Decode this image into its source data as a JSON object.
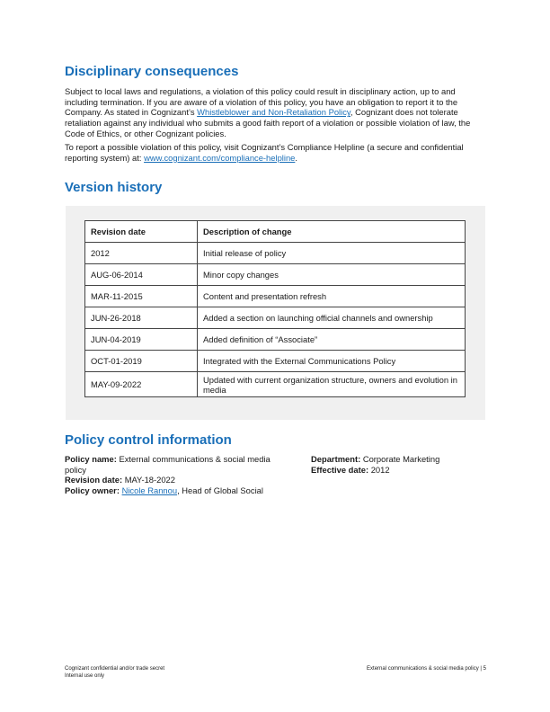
{
  "disciplinary": {
    "heading": "Disciplinary consequences",
    "p1_text_a": "Subject to local laws and regulations, a violation of this policy could result in disciplinary action, up to and including termination. If you are aware of a violation of this policy, you have an obligation to report it to the Company. As stated in Cognizant’s ",
    "p1_link": "Whistleblower and Non-Retaliation Policy",
    "p1_text_b": ", Cognizant does not tolerate retaliation against any individual who submits a good faith report of a violation or possible violation of law, the Code of Ethics, or other Cognizant policies.",
    "p2_text_a": "To report a possible violation of this policy, visit Cognizant’s Compliance Helpline (a secure and confidential reporting system) at: ",
    "p2_link": "www.cognizant.com/compliance-helpline",
    "p2_text_b": "."
  },
  "version_history": {
    "heading": "Version history",
    "columns": [
      "Revision date",
      "Description of change"
    ],
    "rows": [
      {
        "date": "2012",
        "change": "Initial release of policy"
      },
      {
        "date": "AUG-06-2014",
        "change": "Minor copy changes"
      },
      {
        "date": "MAR-11-2015",
        "change": "Content and presentation refresh"
      },
      {
        "date": "JUN-26-2018",
        "change": "Added a section on launching official channels and ownership"
      },
      {
        "date": "JUN-04-2019",
        "change": "Added definition of “Associate”"
      },
      {
        "date": "OCT-01-2019",
        "change": "Integrated with the External Communications Policy"
      },
      {
        "date": "MAY-09-2022",
        "change": "Updated with current organization structure, owners and evolution in media"
      }
    ]
  },
  "policy_control": {
    "heading": "Policy control information",
    "name_label": "Policy name:",
    "name_value": "External communications & social media policy",
    "revision_label": "Revision date:",
    "revision_value": "MAY-18-2022",
    "owner_label": "Policy owner:",
    "owner_link": "Nicole Rannou",
    "owner_rest": ", Head of Global Social",
    "department_label": "Department:",
    "department_value": "Corporate Marketing",
    "effective_label": "Effective date:",
    "effective_value": "2012"
  },
  "footer": {
    "left_line1": "Cognizant confidential and/or trade secret",
    "left_line2": "Internal use only",
    "right": "External communications & social media policy | 5"
  },
  "colors": {
    "heading": "#1a6fb8",
    "link": "#1a6fb8",
    "panel": "#f0f0f0"
  }
}
